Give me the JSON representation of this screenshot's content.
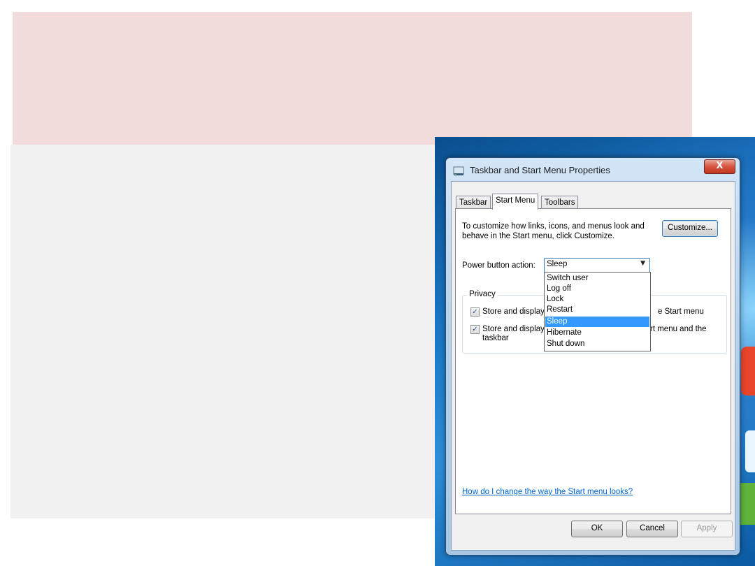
{
  "window": {
    "title": "Taskbar and Start Menu Properties",
    "close_label": "X"
  },
  "tabs": [
    {
      "label": "Taskbar"
    },
    {
      "label": "Start Menu",
      "active": true
    },
    {
      "label": "Toolbars"
    }
  ],
  "start_menu": {
    "description": "To customize how links, icons, and menus look and behave in the Start menu, click Customize.",
    "customize_label": "Customize...",
    "power_button_label": "Power button action:",
    "power_button_value": "Sleep",
    "power_options": [
      "Switch user",
      "Log off",
      "Lock",
      "Restart",
      "Sleep",
      "Hibernate",
      "Shut down"
    ],
    "selected_index": 4,
    "privacy_label": "Privacy",
    "privacy_option1_start": "Store and display r",
    "privacy_option1_end": "e Start menu",
    "privacy_option2_start": "Store and display r",
    "privacy_option2_end": "rt menu and the",
    "privacy_option2_line2": "taskbar",
    "check_mark": "✓",
    "help_link": "How do I change the way the Start menu looks?"
  },
  "footer": {
    "ok_label": "OK",
    "cancel_label": "Cancel",
    "apply_label": "Apply"
  }
}
